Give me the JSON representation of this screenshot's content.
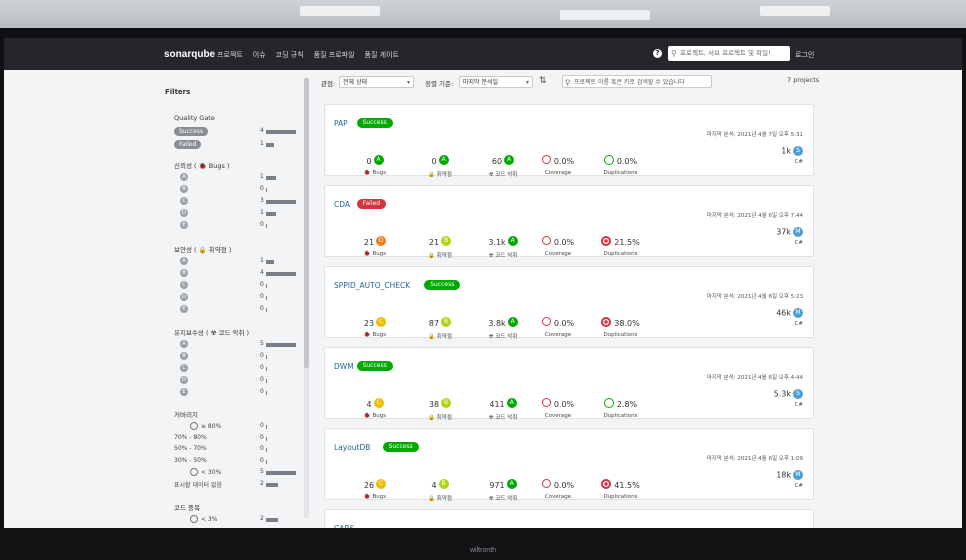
{
  "header": {
    "logo": "sonarqube",
    "nav": [
      "프로젝트",
      "이슈",
      "코딩 규칙",
      "품질 프로파일",
      "품질 게이트"
    ],
    "help": "?",
    "search_placeholder": "프로젝트, 서브 프로젝트 및 파일!",
    "login": "로그인"
  },
  "sidebar": {
    "title": "Filters",
    "quality_gate": {
      "title": "Quality Gate",
      "items": [
        {
          "label": "Success",
          "count": "4",
          "fraction": 1.0
        },
        {
          "label": "Failed",
          "count": "1",
          "fraction": 0.25
        }
      ]
    },
    "reliability": {
      "title": "신뢰성 ( 🐞 Bugs )",
      "items": [
        {
          "label": "A",
          "count": "1",
          "fraction": 0.33
        },
        {
          "label": "B",
          "count": "0",
          "fraction": 0
        },
        {
          "label": "C",
          "count": "3",
          "fraction": 1.0
        },
        {
          "label": "D",
          "count": "1",
          "fraction": 0.33
        },
        {
          "label": "E",
          "count": "0",
          "fraction": 0
        }
      ]
    },
    "security": {
      "title": "보안성 ( 🔒 취약점 )",
      "items": [
        {
          "label": "A",
          "count": "1",
          "fraction": 0.25
        },
        {
          "label": "B",
          "count": "4",
          "fraction": 1.0
        },
        {
          "label": "C",
          "count": "0",
          "fraction": 0
        },
        {
          "label": "D",
          "count": "0",
          "fraction": 0
        },
        {
          "label": "E",
          "count": "0",
          "fraction": 0
        }
      ]
    },
    "maintainability": {
      "title": "유지보수성 ( ☢ 코드 악취 )",
      "items": [
        {
          "label": "A",
          "count": "5",
          "fraction": 1.0
        },
        {
          "label": "B",
          "count": "0",
          "fraction": 0
        },
        {
          "label": "C",
          "count": "0",
          "fraction": 0
        },
        {
          "label": "D",
          "count": "0",
          "fraction": 0
        },
        {
          "label": "E",
          "count": "0",
          "fraction": 0
        }
      ]
    },
    "coverage": {
      "title": "커버리지",
      "items": [
        {
          "label": "≥ 80%",
          "count": "0",
          "fraction": 0
        },
        {
          "label": "70% - 80%",
          "count": "0",
          "fraction": 0
        },
        {
          "label": "50% - 70%",
          "count": "0",
          "fraction": 0
        },
        {
          "label": "30% - 50%",
          "count": "0",
          "fraction": 0
        },
        {
          "label": "< 30%",
          "count": "5",
          "fraction": 1.0
        },
        {
          "label": "표시할 데이터 없음",
          "count": "2",
          "fraction": 0.4
        }
      ]
    },
    "duplications": {
      "title": "코드 중복",
      "items": [
        {
          "label": "< 3%",
          "count": "2",
          "fraction": 0.4
        }
      ]
    }
  },
  "toolbar": {
    "perspective_label": "관점:",
    "perspective_value": "전체 상태",
    "sort_label": "정렬 기준:",
    "sort_value": "마지막 분석일",
    "search_placeholder": "프로젝트 이름 혹은 키로 검색할 수 있습니다",
    "project_count": "7 projects"
  },
  "metric_labels": {
    "bugs": "Bugs",
    "vulnerabilities": "취약점",
    "code_smells": "코드 악취",
    "coverage": "Coverage",
    "duplications": "Duplications"
  },
  "colors": {
    "A": "#00aa00",
    "B": "#b0d513",
    "C": "#eabe06",
    "D": "#ed7d20",
    "E": "#d4333f",
    "success": "#00aa00",
    "failed": "#d4333f",
    "size": "#4b9fd5"
  },
  "projects": [
    {
      "name": "PAP",
      "status": "Success",
      "status_type": "ok",
      "analysis": "마지막 분석: 2021년 4월 7일 오후 5:31",
      "bugs": "0",
      "bugs_rating": "A",
      "vulns": "0",
      "vulns_rating": "A",
      "smells": "60",
      "smells_rating": "A",
      "coverage": "0.0%",
      "duplications": "0.0%",
      "dup_level": "low",
      "size": "1k",
      "size_rating": "S",
      "lang": "C#"
    },
    {
      "name": "CDA",
      "status": "Failed",
      "status_type": "fail",
      "analysis": "마지막 분석: 2021년 4월 6일 오후 7:44",
      "bugs": "21",
      "bugs_rating": "D",
      "vulns": "21",
      "vulns_rating": "B",
      "smells": "3.1k",
      "smells_rating": "A",
      "coverage": "0.0%",
      "duplications": "21.5%",
      "dup_level": "high",
      "size": "37k",
      "size_rating": "M",
      "lang": "C#"
    },
    {
      "name": "SPPID_AUTO_CHECK",
      "status": "Success",
      "status_type": "ok",
      "analysis": "마지막 분석: 2021년 4월 6일 오후 5:23",
      "bugs": "23",
      "bugs_rating": "C",
      "vulns": "87",
      "vulns_rating": "B",
      "smells": "3.8k",
      "smells_rating": "A",
      "coverage": "0.0%",
      "duplications": "38.0%",
      "dup_level": "high",
      "size": "46k",
      "size_rating": "M",
      "lang": "C#"
    },
    {
      "name": "DWM",
      "status": "Success",
      "status_type": "ok",
      "analysis": "마지막 분석: 2021년 4월 6일 오후 4:44",
      "bugs": "4",
      "bugs_rating": "C",
      "vulns": "38",
      "vulns_rating": "B",
      "smells": "411",
      "smells_rating": "A",
      "coverage": "0.0%",
      "duplications": "2.8%",
      "dup_level": "low",
      "size": "5.3k",
      "size_rating": "S",
      "lang": "C#"
    },
    {
      "name": "LayoutDB",
      "status": "Success",
      "status_type": "ok",
      "analysis": "마지막 분석: 2021년 4월 6일 오후 1:09",
      "bugs": "26",
      "bugs_rating": "C",
      "vulns": "4",
      "vulns_rating": "B",
      "smells": "971",
      "smells_rating": "A",
      "coverage": "0.0%",
      "duplications": "41.5%",
      "dup_level": "high",
      "size": "18k",
      "size_rating": "M",
      "lang": "C#"
    },
    {
      "name": "CARS",
      "partial": true
    }
  ],
  "monitor_brand": "wiltronth"
}
